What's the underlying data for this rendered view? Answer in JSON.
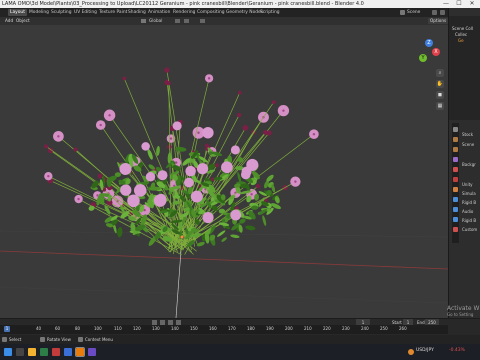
{
  "window": {
    "title": "LAMA OMO\\3d Model\\Plants\\03_Processing to Upload\\LC20112 Geranium - pink cranesbill\\Blender\\Geranium - pink cranesbill.blend - Blender 4.0",
    "minimize": "—",
    "maximize": "☐",
    "close": "✕"
  },
  "workspaces": [
    "Layout",
    "Modeling",
    "Sculpting",
    "UV Editing",
    "Texture Paint",
    "Shading",
    "Animation",
    "Rendering",
    "Compositing",
    "Geometry Nodes",
    "Scripting"
  ],
  "scene_label": "Scene",
  "viewport_header": {
    "menus": [
      "Add",
      "Object"
    ],
    "orientation": "Global",
    "options": "Options"
  },
  "gizmo": {
    "axes": [
      "X",
      "Y",
      "Z"
    ],
    "nav_icons": [
      "zoom-icon",
      "hand-icon",
      "camera-icon",
      "grid-icon"
    ]
  },
  "outliner": {
    "rows": [
      "Scene Coll",
      "Collec",
      "Ge"
    ]
  },
  "properties": {
    "header": "Stock",
    "rows": [
      "Scene",
      "Backgr",
      "Unity",
      "Simula",
      "Rigid B",
      "Audio",
      "Rigid B",
      "Custom"
    ]
  },
  "timeline": {
    "frame_current": "1",
    "start_label": "Start",
    "start": "1",
    "end_label": "End",
    "end": "250",
    "ticks": [
      "0",
      "40",
      "60",
      "80",
      "100",
      "120",
      "140",
      "160",
      "180",
      "200",
      "220",
      "240",
      "260",
      "280",
      "300",
      "320"
    ],
    "ruler_ticks": [
      "1",
      "40",
      "60",
      "80",
      "100",
      "110",
      "120",
      "130",
      "140",
      "150",
      "160",
      "170",
      "180",
      "190",
      "200",
      "210",
      "220",
      "230",
      "240",
      "250",
      "260"
    ]
  },
  "status": {
    "select": "Select",
    "rotate": "Rotate View",
    "context": "Context Menu"
  },
  "activate_windows": {
    "line1": "Activate W",
    "line2": "Go to Setting"
  },
  "taskbar": {
    "weather": "USD/JPY",
    "change": "-0.43%"
  },
  "colors": {
    "viewport_bg": "#3a3a3a",
    "accent": "#4772b3",
    "x_axis": "#e0404a",
    "y_axis": "#6fbd2c",
    "z_axis": "#3f7fe0",
    "origin": "#ff8a3d"
  }
}
